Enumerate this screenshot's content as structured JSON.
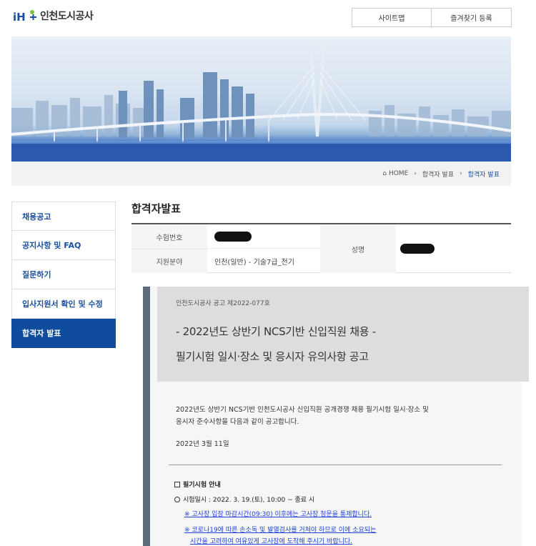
{
  "header": {
    "logo_text": "인천도시공사",
    "links": [
      "사이트맵",
      "즐겨찾기 등록"
    ]
  },
  "breadcrumb": {
    "home": "HOME",
    "items": [
      "합격자 발표",
      "합격자 발표"
    ]
  },
  "sidebar": {
    "items": [
      {
        "label": "채용공고"
      },
      {
        "label": "공지사항 및 FAQ"
      },
      {
        "label": "질문하기"
      },
      {
        "label": "입사지원서 확인 및 수정"
      },
      {
        "label": "합격자 발표"
      }
    ]
  },
  "main": {
    "title": "합격자발표",
    "info": {
      "exam_no_label": "수험번호",
      "field_label": "지원분야",
      "field_value": "인천(일반) - 기술7급_전기",
      "name_label": "성명"
    }
  },
  "notice": {
    "number": "인천도시공사 공고 제2022-077호",
    "title1": "- 2022년도 상반기 NCS기반 신입직원 채용 -",
    "title2": "필기시험 일시·장소 및 응시자 유의사항 공고",
    "body_line1": "2022년도 상반기 NCS기반 인천도시공사 신입직원 공개경쟁 채용 필기시험 일시·장소 및",
    "body_line2": "응시자 준수사항을 다음과 같이 공고합니다.",
    "date": "2022년 3월 11일",
    "section_title": "필기시험 안내",
    "exam_datetime": "시험일시 : 2022. 3. 19.(토), 10:00 ~ 종료 시",
    "warn1": "※ 고사장 입장 마감시간(09:30) 이후에는 고사장 청문을 통제합니다.",
    "warn2_line1": "※ 코로나19에 따른 손소독 및 발열검사를 거쳐야 하므로 이에 소요되는",
    "warn2_line2": "시간을 고려하여 여유있게 고사장에 도착해 주시기 바랍니다."
  },
  "colors": {
    "brand_blue": "#0f4c9e",
    "link_blue": "#1d3fd6"
  }
}
